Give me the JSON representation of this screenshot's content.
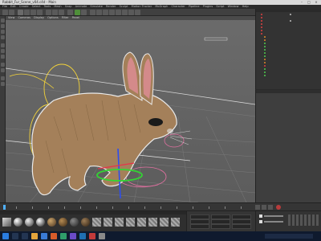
{
  "window": {
    "title": "Rabbit_Fur_Scene_v04.c4d - Main"
  },
  "menu": {
    "items": [
      "File",
      "Edit",
      "Create",
      "Select",
      "Tools",
      "Mesh",
      "Snap",
      "Animate",
      "Simulate",
      "Render",
      "Sculpt",
      "Motion Tracker",
      "MoGraph",
      "Character",
      "Pipeline",
      "Plugins",
      "Script",
      "Window",
      "Help"
    ]
  },
  "viewport": {
    "menu": [
      "View",
      "Cameras",
      "Display",
      "Options",
      "Filter",
      "Panel"
    ]
  },
  "object_manager": {
    "rows": [
      {
        "color": "#e04040"
      },
      {
        "color": "#e04040"
      },
      {
        "color": "#e04040"
      },
      {
        "color": "#e04040"
      },
      {
        "color": "#e04040"
      },
      {
        "color": "#e04040"
      },
      {
        "color": "#e04040"
      },
      {
        "color": "#e08a2a"
      },
      {
        "color": "#e08a2a"
      },
      {
        "color": "#4fd04f"
      },
      {
        "color": "#4fd04f"
      },
      {
        "color": "#4fd04f"
      },
      {
        "color": "#4fd04f"
      },
      {
        "color": "#4fd04f"
      },
      {
        "color": "#e08a2a"
      },
      {
        "color": "#e08a2a"
      },
      {
        "color": "#e04040"
      },
      {
        "color": "#4fd04f"
      },
      {
        "color": "#4fd04f"
      },
      {
        "color": "#4fd04f"
      }
    ]
  },
  "colors": {
    "accent": "#4fb0ff",
    "fur": "#a4805a",
    "gizmo_green": "#33d433",
    "gizmo_blue": "#2c4df0",
    "taskbar": "#0f1a2e"
  }
}
